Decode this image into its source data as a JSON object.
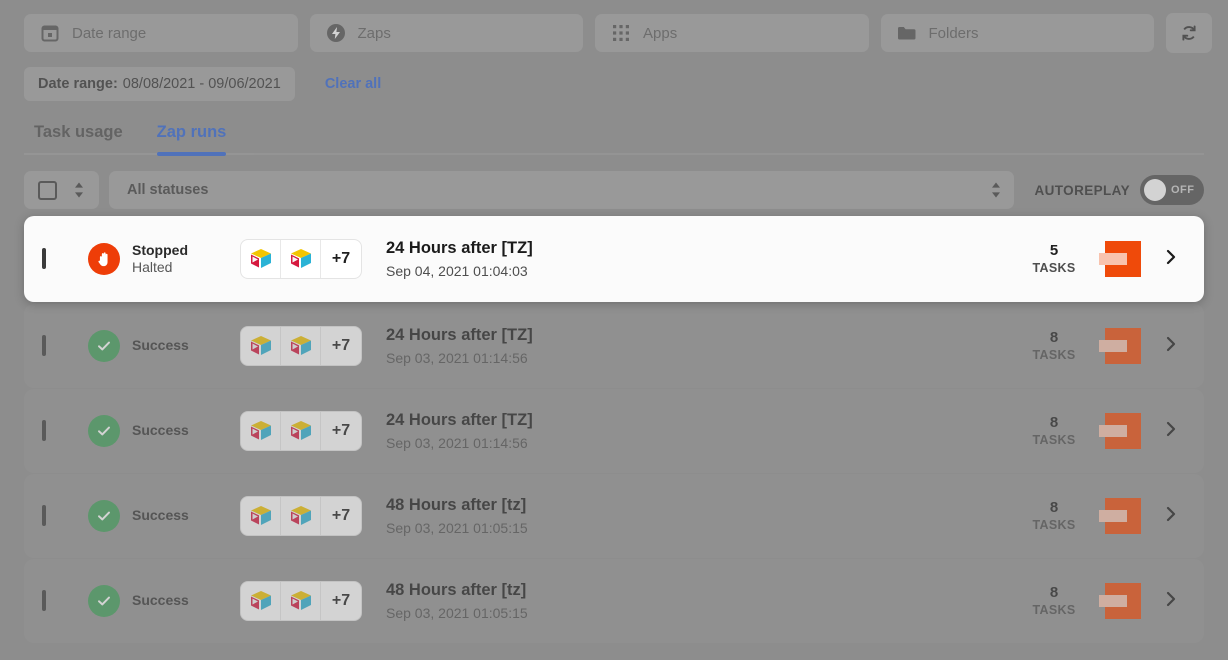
{
  "filters": {
    "date_range": {
      "label": "Date range",
      "icon": "calendar-icon"
    },
    "zaps": {
      "label": "Zaps",
      "icon": "lightning-bolt-icon"
    },
    "apps": {
      "label": "Apps",
      "icon": "grid-apps-icon"
    },
    "folders": {
      "label": "Folders",
      "icon": "folder-icon"
    },
    "refresh": {
      "icon": "refresh-icon"
    }
  },
  "active_filters": {
    "chip_label": "Date range:",
    "chip_value": "08/08/2021 - 09/06/2021",
    "clear_all": "Clear all"
  },
  "tabs": [
    {
      "label": "Task usage",
      "active": false
    },
    {
      "label": "Zap runs",
      "active": true
    }
  ],
  "toolbar": {
    "select_all_checked": false,
    "sorter_icon": "sort-updown-icon",
    "status_filter_value": "All statuses",
    "status_filter_icon": "sort-updown-icon",
    "autoreplay_label": "AUTOREPLAY",
    "autoreplay_state": "OFF"
  },
  "runs": [
    {
      "highlight": true,
      "status_line1": "Stopped",
      "status_line2": "Halted",
      "status_kind": "stopped",
      "status_icon": "stop-hand-icon",
      "apps_more": "+7",
      "title": "24 Hours after [TZ]",
      "timestamp": "Sep 04, 2021 01:04:03",
      "tasks_count": "5",
      "tasks_label": "TASKS",
      "brand_icon": "brand-square-logo",
      "chevron_icon": "chevron-right-icon"
    },
    {
      "highlight": false,
      "status_line1": "Success",
      "status_line2": "",
      "status_kind": "success",
      "status_icon": "check-circle-icon",
      "apps_more": "+7",
      "title": "24 Hours after [TZ]",
      "timestamp": "Sep 03, 2021 01:14:56",
      "tasks_count": "8",
      "tasks_label": "TASKS",
      "brand_icon": "brand-square-logo",
      "chevron_icon": "chevron-right-icon"
    },
    {
      "highlight": false,
      "status_line1": "Success",
      "status_line2": "",
      "status_kind": "success",
      "status_icon": "check-circle-icon",
      "apps_more": "+7",
      "title": "24 Hours after [TZ]",
      "timestamp": "Sep 03, 2021 01:14:56",
      "tasks_count": "8",
      "tasks_label": "TASKS",
      "brand_icon": "brand-square-logo",
      "chevron_icon": "chevron-right-icon"
    },
    {
      "highlight": false,
      "status_line1": "Success",
      "status_line2": "",
      "status_kind": "success",
      "status_icon": "check-circle-icon",
      "apps_more": "+7",
      "title": "48 Hours after [tz]",
      "timestamp": "Sep 03, 2021 01:05:15",
      "tasks_count": "8",
      "tasks_label": "TASKS",
      "brand_icon": "brand-square-logo",
      "chevron_icon": "chevron-right-icon"
    },
    {
      "highlight": false,
      "status_line1": "Success",
      "status_line2": "",
      "status_kind": "success",
      "status_icon": "check-circle-icon",
      "apps_more": "+7",
      "title": "48 Hours after [tz]",
      "timestamp": "Sep 03, 2021 01:05:15",
      "tasks_count": "8",
      "tasks_label": "TASKS",
      "brand_icon": "brand-square-logo",
      "chevron_icon": "chevron-right-icon"
    }
  ],
  "colors": {
    "accent_blue": "#2c62d6",
    "success_green": "#3f9e58",
    "stopped_red": "#ee3d08",
    "brand_orange": "#ef4a0a",
    "page_dim": "#8d8d8d"
  }
}
